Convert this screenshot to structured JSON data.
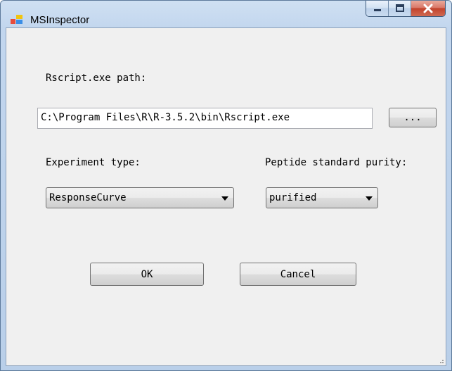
{
  "window": {
    "title": "MSInspector"
  },
  "form": {
    "rscript_label": "Rscript.exe path:",
    "rscript_path": "C:\\Program Files\\R\\R-3.5.2\\bin\\Rscript.exe",
    "browse_label": "...",
    "experiment_label": "Experiment type:",
    "experiment_value": "ResponseCurve",
    "purity_label": "Peptide standard purity:",
    "purity_value": "purified",
    "ok_label": "OK",
    "cancel_label": "Cancel"
  },
  "icons": {
    "app": "app-icon",
    "minimize": "minimize-icon",
    "maximize": "maximize-icon",
    "close": "close-icon",
    "dropdown": "chevron-down-icon"
  },
  "colors": {
    "frame": "#c2d6ee",
    "client": "#f0f0f0",
    "close_button": "#c2422c"
  }
}
